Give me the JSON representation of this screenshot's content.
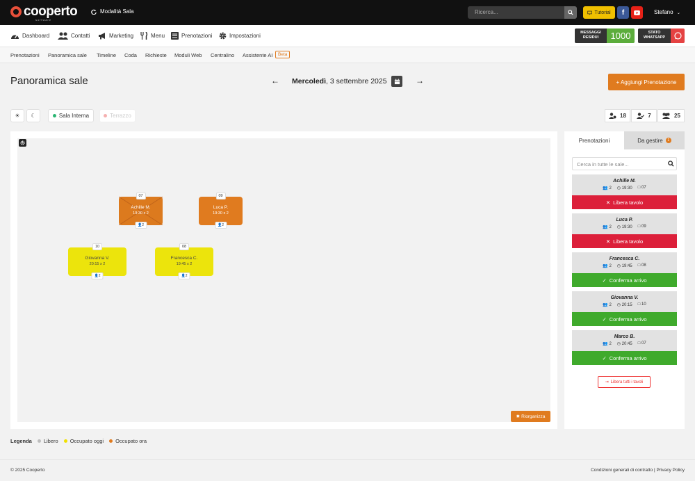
{
  "topbar": {
    "logo_text": "cooperto",
    "logo_sub": "software",
    "mode_label": "Modalità Sala",
    "search_placeholder": "Ricerca...",
    "tutorial_label": "Tutorial",
    "facebook_label": "f",
    "user_name": "Stefano"
  },
  "nav": {
    "items": [
      {
        "label": "Dashboard",
        "icon": "dashboard-icon"
      },
      {
        "label": "Contatti",
        "icon": "users-icon"
      },
      {
        "label": "Marketing",
        "icon": "megaphone-icon"
      },
      {
        "label": "Menu",
        "icon": "cutlery-icon"
      },
      {
        "label": "Prenotazioni",
        "icon": "list-icon"
      },
      {
        "label": "Impostazioni",
        "icon": "gear-icon"
      }
    ],
    "messages_label": "MESSAGGI RESIDUI",
    "messages_count": "1000",
    "whatsapp_label": "STATO WHATSAPP"
  },
  "subnav": {
    "items": [
      "Prenotazioni",
      "Panoramica sale",
      "Timeline",
      "Coda",
      "Richieste",
      "Moduli Web",
      "Centralino",
      "Assistente AI"
    ],
    "beta_label": "Beta"
  },
  "header": {
    "title": "Panoramica sale",
    "day": "Mercoledì",
    "date": ", 3 settembre 2025",
    "add_label": "+ Aggiungi Prenotazione"
  },
  "rooms": {
    "active": "Sala Interna",
    "inactive": "Terrazzo"
  },
  "stats": {
    "guests_to_arrive": "18",
    "guests_arrived": "7",
    "guests_total": "25"
  },
  "floor": {
    "tables": [
      {
        "number": "07",
        "name": "Achille M.",
        "time": "19:30 x 2",
        "seats": "2",
        "status": "occupato-ora"
      },
      {
        "number": "09",
        "name": "Luca P.",
        "time": "19:30 x 2",
        "seats": "2",
        "status": "occupato-ora"
      },
      {
        "number": "10",
        "name": "Giovanna V.",
        "time": "20:15 x 2",
        "seats": "2",
        "status": "occupato-oggi"
      },
      {
        "number": "08",
        "name": "Francesca C.",
        "time": "19:45 x 2",
        "seats": "2",
        "status": "occupato-oggi"
      }
    ],
    "reorganize_label": "Riorganizza"
  },
  "legend": {
    "title": "Legenda",
    "libero": "Libero",
    "oggi": "Occupato oggi",
    "ora": "Occupato ora",
    "colors": {
      "libero": "#bdbdbd",
      "oggi": "#f0e000",
      "ora": "#e07b1f"
    }
  },
  "side": {
    "tab_prenotazioni": "Prenotazioni",
    "tab_gestire": "Da gestire",
    "gestire_count": "1",
    "search_placeholder": "Cerca in tutte le sale...",
    "reservations": [
      {
        "name": "Achille M.",
        "people": "2",
        "time": "19:30",
        "table": "07",
        "action": "Libera tavolo",
        "action_type": "libera"
      },
      {
        "name": "Luca P.",
        "people": "2",
        "time": "19:30",
        "table": "09",
        "action": "Libera tavolo",
        "action_type": "libera"
      },
      {
        "name": "Francesca C.",
        "people": "2",
        "time": "19:45",
        "table": "08",
        "action": "Conferma arrivo",
        "action_type": "conferma"
      },
      {
        "name": "Giovanna V.",
        "people": "2",
        "time": "20:15",
        "table": "10",
        "action": "Conferma arrivo",
        "action_type": "conferma"
      },
      {
        "name": "Marco B.",
        "people": "2",
        "time": "20:45",
        "table": "07",
        "action": "Conferma arrivo",
        "action_type": "conferma"
      }
    ],
    "free_all_label": "Libera tutti i tavoli"
  },
  "footer": {
    "copyright": "© 2025 Cooperto",
    "terms": "Condizioni generali di contratto",
    "privacy": "Privacy Policy"
  }
}
